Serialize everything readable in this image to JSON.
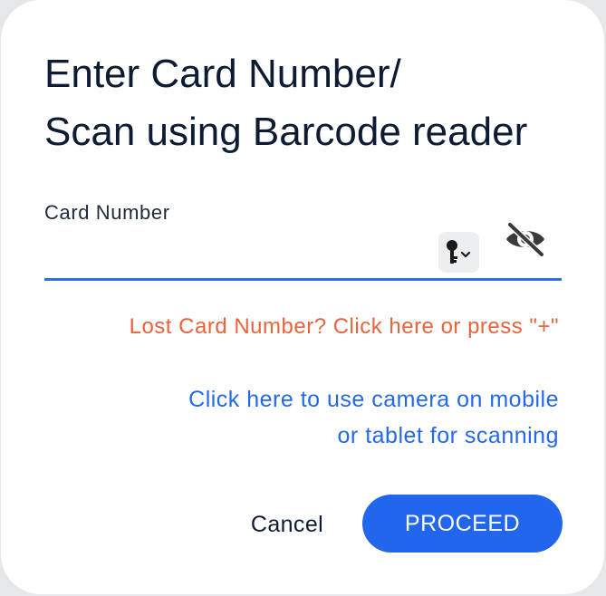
{
  "dialog": {
    "title_line1": "Enter Card Number/",
    "title_line2": "Scan using Barcode reader",
    "field": {
      "label": "Card Number",
      "value": "",
      "key_icon": "key-dropdown-icon",
      "visibility_icon": "eye-off-icon"
    },
    "lost_card_link": "Lost Card Number? Click here or press \"+\"",
    "camera_link_line1": "Click here to use camera on mobile",
    "camera_link_line2": "or tablet for scanning",
    "cancel_label": "Cancel",
    "proceed_label": "PROCEED"
  },
  "colors": {
    "accent": "#2366ee",
    "link": "#2469ea",
    "warning_link": "#e8643c",
    "title": "#0d1b33"
  }
}
